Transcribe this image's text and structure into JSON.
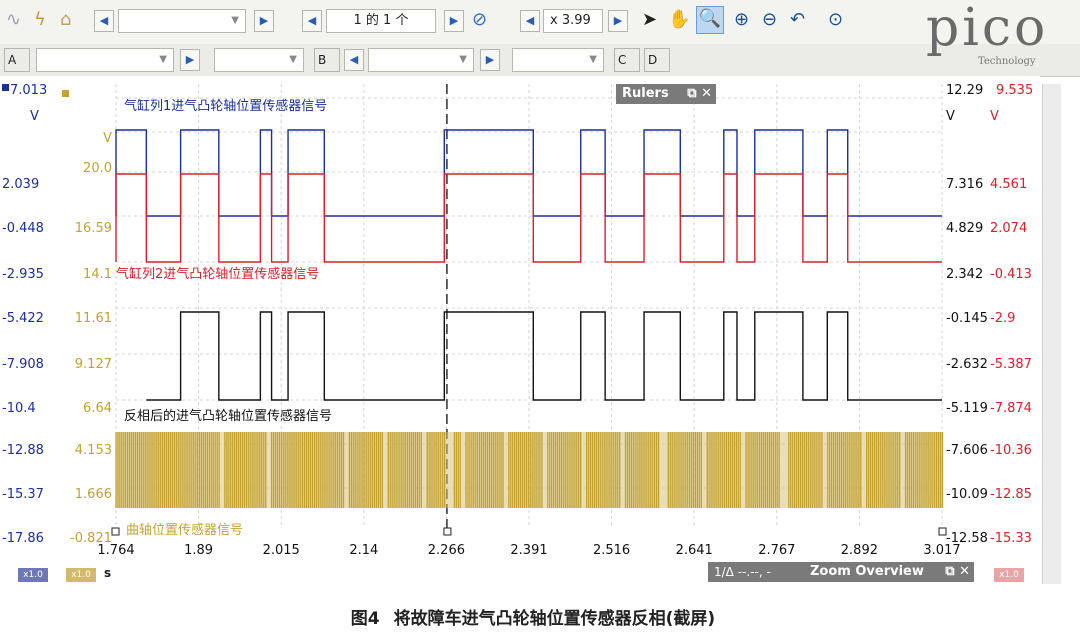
{
  "toolbar": {
    "page_label": "1 的 1 个",
    "zoom_label": "x 3.99",
    "channels": [
      "A",
      "B",
      "C",
      "D"
    ]
  },
  "logo": {
    "word": "pico",
    "sub": "Technology"
  },
  "rulers_window": {
    "title": "Rulers"
  },
  "zoom_overview": {
    "title": "Zoom Overview",
    "ruler_readout": "1/Δ --.--, -"
  },
  "status": {
    "unit": "s",
    "scale_a": "x1.0",
    "scale_b": "x1.0",
    "scale_r": "x1.0"
  },
  "colors": {
    "blue": "#1a2f9c",
    "red": "#d8202a",
    "black": "#111111",
    "gold": "#c3a231"
  },
  "chart_data": {
    "type": "line",
    "x": {
      "min": 1.764,
      "max": 3.017,
      "ticks": [
        "1.764",
        "1.89",
        "2.015",
        "2.14",
        "2.266",
        "2.391",
        "2.516",
        "2.641",
        "2.767",
        "2.892",
        "3.017"
      ],
      "unit": "s"
    },
    "axes_left": {
      "blue": [
        "7.013",
        "V",
        "2.039",
        "-0.448",
        "-2.935",
        "-5.422",
        "-7.908",
        "-10.4",
        "-12.88",
        "-15.37",
        "-17.86"
      ],
      "gold": [
        "V",
        "20.0",
        "16.59",
        "14.1",
        "11.61",
        "9.127",
        "6.64",
        "4.153",
        "1.666",
        "-0.821"
      ]
    },
    "axes_right": {
      "black": [
        "12.29",
        "V",
        "7.316",
        "4.829",
        "2.342",
        "-0.145",
        "-2.632",
        "-5.119",
        "-7.606",
        "-10.09",
        "-12.58"
      ],
      "red": [
        "9.535",
        "V",
        "4.561",
        "2.074",
        "-0.413",
        "-2.9",
        "-5.387",
        "-7.874",
        "-10.36",
        "-12.85",
        "-15.33"
      ]
    },
    "ruler_x": 2.266,
    "grid": true,
    "series": [
      {
        "name": "气缸列1进气凸轮轴位置传感器信号",
        "color": "#1a2f9c",
        "base": 0,
        "high_intervals": [
          [
            1.764,
            1.81
          ],
          [
            1.862,
            1.92
          ],
          [
            1.983,
            2.0
          ],
          [
            2.025,
            2.08
          ],
          [
            2.262,
            2.397
          ],
          [
            2.469,
            2.506
          ],
          [
            2.565,
            2.62
          ],
          [
            2.686,
            2.706
          ],
          [
            2.733,
            2.806
          ],
          [
            2.843,
            2.874
          ]
        ]
      },
      {
        "name": "气缸列2进气凸轮轴位置传感器信号",
        "color": "#d8202a",
        "base": 0,
        "high_intervals": [
          [
            1.764,
            1.81
          ],
          [
            1.862,
            1.92
          ],
          [
            1.983,
            2.0
          ],
          [
            2.025,
            2.08
          ],
          [
            2.262,
            2.397
          ],
          [
            2.469,
            2.506
          ],
          [
            2.565,
            2.62
          ],
          [
            2.686,
            2.706
          ],
          [
            2.733,
            2.806
          ],
          [
            2.843,
            2.874
          ]
        ]
      },
      {
        "name": "反相后的进气凸轮轴位置传感器信号",
        "color": "#111111",
        "base": 0,
        "high_intervals": [
          [
            1.862,
            1.92
          ],
          [
            1.983,
            2.0
          ],
          [
            2.025,
            2.08
          ],
          [
            2.262,
            2.397
          ],
          [
            2.469,
            2.506
          ],
          [
            2.565,
            2.62
          ],
          [
            2.686,
            2.706
          ],
          [
            2.733,
            2.806
          ],
          [
            2.843,
            2.874
          ]
        ]
      },
      {
        "name": "曲轴位置传感器信号",
        "color": "#c3a231",
        "base": 0,
        "period": 0.0059,
        "gaps": [
          [
            1.923,
            1.929
          ],
          [
            1.989,
            1.996
          ],
          [
            2.048,
            2.053
          ],
          [
            2.107,
            2.113
          ],
          [
            2.168,
            2.174
          ],
          [
            2.228,
            2.234
          ],
          [
            2.264,
            2.272
          ],
          [
            2.289,
            2.295
          ],
          [
            2.349,
            2.355
          ],
          [
            2.41,
            2.416
          ],
          [
            2.469,
            2.476
          ],
          [
            2.53,
            2.536
          ],
          [
            2.59,
            2.597
          ],
          [
            2.651,
            2.657
          ],
          [
            2.712,
            2.718
          ],
          [
            2.772,
            2.779
          ],
          [
            2.833,
            2.839
          ],
          [
            2.893,
            2.9
          ],
          [
            2.954,
            2.96
          ]
        ]
      }
    ]
  },
  "caption": {
    "fig": "图4",
    "text": "将故障车进气凸轮轴位置传感器反相(截屏)"
  }
}
